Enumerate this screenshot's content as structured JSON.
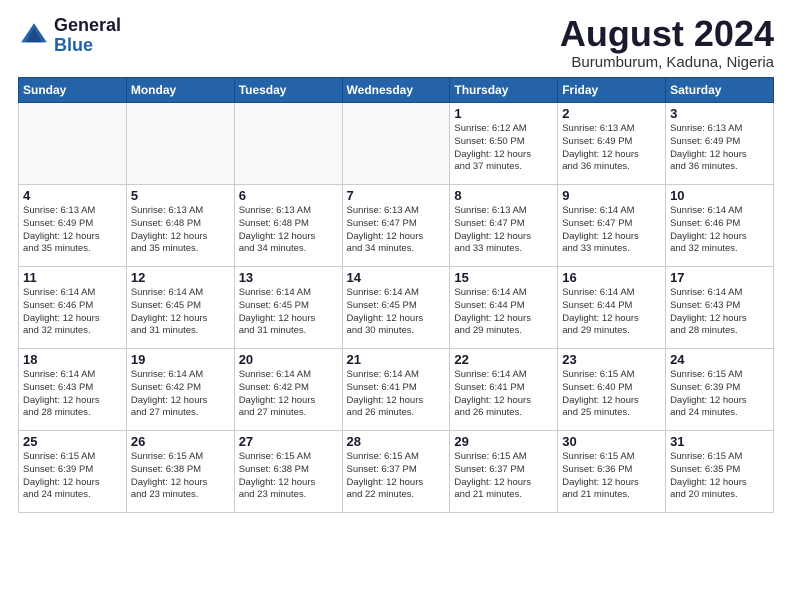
{
  "logo": {
    "general": "General",
    "blue": "Blue"
  },
  "title": "August 2024",
  "subtitle": "Burumburum, Kaduna, Nigeria",
  "weekdays": [
    "Sunday",
    "Monday",
    "Tuesday",
    "Wednesday",
    "Thursday",
    "Friday",
    "Saturday"
  ],
  "weeks": [
    [
      {
        "day": "",
        "info": ""
      },
      {
        "day": "",
        "info": ""
      },
      {
        "day": "",
        "info": ""
      },
      {
        "day": "",
        "info": ""
      },
      {
        "day": "1",
        "info": "Sunrise: 6:12 AM\nSunset: 6:50 PM\nDaylight: 12 hours\nand 37 minutes."
      },
      {
        "day": "2",
        "info": "Sunrise: 6:13 AM\nSunset: 6:49 PM\nDaylight: 12 hours\nand 36 minutes."
      },
      {
        "day": "3",
        "info": "Sunrise: 6:13 AM\nSunset: 6:49 PM\nDaylight: 12 hours\nand 36 minutes."
      }
    ],
    [
      {
        "day": "4",
        "info": "Sunrise: 6:13 AM\nSunset: 6:49 PM\nDaylight: 12 hours\nand 35 minutes."
      },
      {
        "day": "5",
        "info": "Sunrise: 6:13 AM\nSunset: 6:48 PM\nDaylight: 12 hours\nand 35 minutes."
      },
      {
        "day": "6",
        "info": "Sunrise: 6:13 AM\nSunset: 6:48 PM\nDaylight: 12 hours\nand 34 minutes."
      },
      {
        "day": "7",
        "info": "Sunrise: 6:13 AM\nSunset: 6:47 PM\nDaylight: 12 hours\nand 34 minutes."
      },
      {
        "day": "8",
        "info": "Sunrise: 6:13 AM\nSunset: 6:47 PM\nDaylight: 12 hours\nand 33 minutes."
      },
      {
        "day": "9",
        "info": "Sunrise: 6:14 AM\nSunset: 6:47 PM\nDaylight: 12 hours\nand 33 minutes."
      },
      {
        "day": "10",
        "info": "Sunrise: 6:14 AM\nSunset: 6:46 PM\nDaylight: 12 hours\nand 32 minutes."
      }
    ],
    [
      {
        "day": "11",
        "info": "Sunrise: 6:14 AM\nSunset: 6:46 PM\nDaylight: 12 hours\nand 32 minutes."
      },
      {
        "day": "12",
        "info": "Sunrise: 6:14 AM\nSunset: 6:45 PM\nDaylight: 12 hours\nand 31 minutes."
      },
      {
        "day": "13",
        "info": "Sunrise: 6:14 AM\nSunset: 6:45 PM\nDaylight: 12 hours\nand 31 minutes."
      },
      {
        "day": "14",
        "info": "Sunrise: 6:14 AM\nSunset: 6:45 PM\nDaylight: 12 hours\nand 30 minutes."
      },
      {
        "day": "15",
        "info": "Sunrise: 6:14 AM\nSunset: 6:44 PM\nDaylight: 12 hours\nand 29 minutes."
      },
      {
        "day": "16",
        "info": "Sunrise: 6:14 AM\nSunset: 6:44 PM\nDaylight: 12 hours\nand 29 minutes."
      },
      {
        "day": "17",
        "info": "Sunrise: 6:14 AM\nSunset: 6:43 PM\nDaylight: 12 hours\nand 28 minutes."
      }
    ],
    [
      {
        "day": "18",
        "info": "Sunrise: 6:14 AM\nSunset: 6:43 PM\nDaylight: 12 hours\nand 28 minutes."
      },
      {
        "day": "19",
        "info": "Sunrise: 6:14 AM\nSunset: 6:42 PM\nDaylight: 12 hours\nand 27 minutes."
      },
      {
        "day": "20",
        "info": "Sunrise: 6:14 AM\nSunset: 6:42 PM\nDaylight: 12 hours\nand 27 minutes."
      },
      {
        "day": "21",
        "info": "Sunrise: 6:14 AM\nSunset: 6:41 PM\nDaylight: 12 hours\nand 26 minutes."
      },
      {
        "day": "22",
        "info": "Sunrise: 6:14 AM\nSunset: 6:41 PM\nDaylight: 12 hours\nand 26 minutes."
      },
      {
        "day": "23",
        "info": "Sunrise: 6:15 AM\nSunset: 6:40 PM\nDaylight: 12 hours\nand 25 minutes."
      },
      {
        "day": "24",
        "info": "Sunrise: 6:15 AM\nSunset: 6:39 PM\nDaylight: 12 hours\nand 24 minutes."
      }
    ],
    [
      {
        "day": "25",
        "info": "Sunrise: 6:15 AM\nSunset: 6:39 PM\nDaylight: 12 hours\nand 24 minutes."
      },
      {
        "day": "26",
        "info": "Sunrise: 6:15 AM\nSunset: 6:38 PM\nDaylight: 12 hours\nand 23 minutes."
      },
      {
        "day": "27",
        "info": "Sunrise: 6:15 AM\nSunset: 6:38 PM\nDaylight: 12 hours\nand 23 minutes."
      },
      {
        "day": "28",
        "info": "Sunrise: 6:15 AM\nSunset: 6:37 PM\nDaylight: 12 hours\nand 22 minutes."
      },
      {
        "day": "29",
        "info": "Sunrise: 6:15 AM\nSunset: 6:37 PM\nDaylight: 12 hours\nand 21 minutes."
      },
      {
        "day": "30",
        "info": "Sunrise: 6:15 AM\nSunset: 6:36 PM\nDaylight: 12 hours\nand 21 minutes."
      },
      {
        "day": "31",
        "info": "Sunrise: 6:15 AM\nSunset: 6:35 PM\nDaylight: 12 hours\nand 20 minutes."
      }
    ]
  ]
}
